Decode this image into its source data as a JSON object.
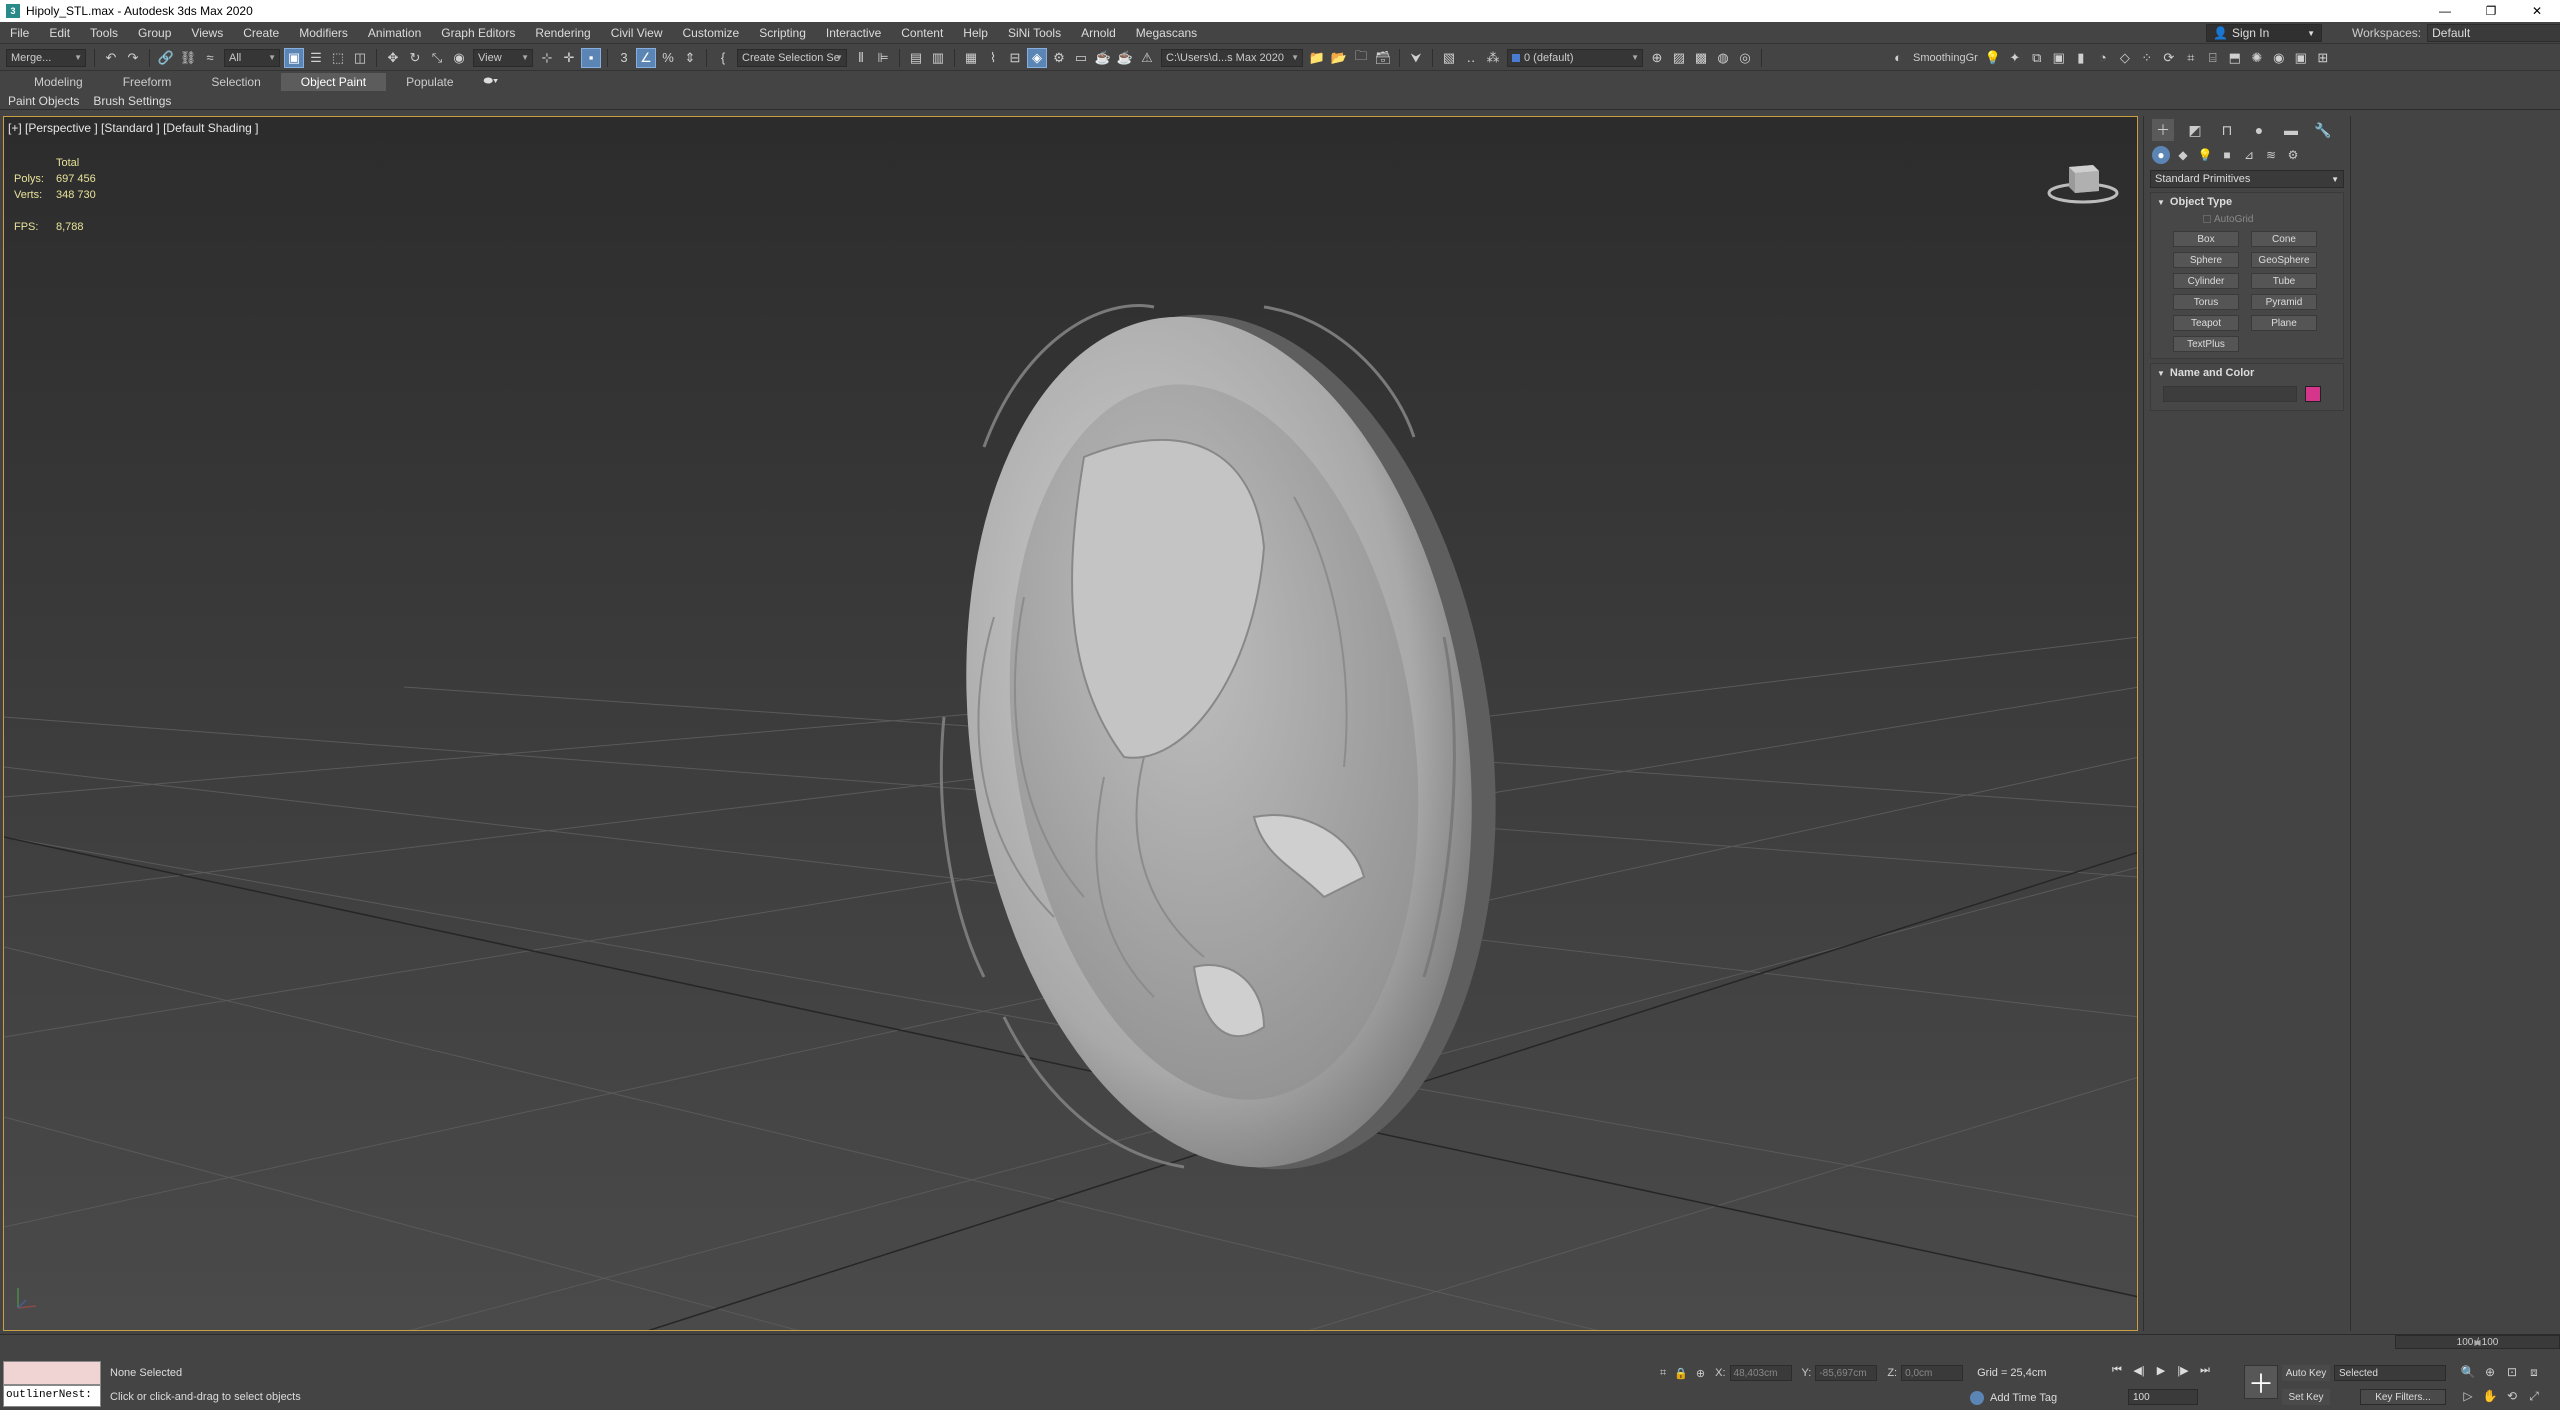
{
  "window": {
    "title": "Hipoly_STL.max - Autodesk 3ds Max 2020",
    "app_icon": "3",
    "minimize": "—",
    "restore": "❐",
    "close": "✕"
  },
  "menu": {
    "items": [
      "File",
      "Edit",
      "Tools",
      "Group",
      "Views",
      "Create",
      "Modifiers",
      "Animation",
      "Graph Editors",
      "Rendering",
      "Civil View",
      "Customize",
      "Scripting",
      "Interactive",
      "Content",
      "Help",
      "SiNi Tools",
      "Arnold",
      "Megascans"
    ],
    "sign_in": "Sign In",
    "workspaces_label": "Workspaces:",
    "workspaces_value": "Default"
  },
  "toolbar": {
    "merge": "Merge...",
    "selection_filter": "All",
    "ref_coord": "View",
    "named_selection": "Create Selection Se",
    "project_path": "C:\\Users\\d...s Max 2020",
    "layer": "0 (default)",
    "smoothing": "SmoothingGr"
  },
  "ribbon": {
    "tabs": [
      "Modeling",
      "Freeform",
      "Selection",
      "Object Paint",
      "Populate"
    ],
    "active_tab": "Object Paint",
    "sub_items": [
      "Paint Objects",
      "Brush Settings"
    ]
  },
  "viewport": {
    "label": "[+] [Perspective ] [Standard ] [Default Shading ]",
    "stats": {
      "total_label": "Total",
      "polys_label": "Polys:",
      "polys_value": "697 456",
      "verts_label": "Verts:",
      "verts_value": "348 730",
      "fps_label": "FPS:",
      "fps_value": "8,788"
    }
  },
  "command_panel": {
    "category": "Standard Primitives",
    "object_type_title": "Object Type",
    "autogrid": "AutoGrid",
    "primitives": [
      "Box",
      "Cone",
      "Sphere",
      "GeoSphere",
      "Cylinder",
      "Tube",
      "Torus",
      "Pyramid",
      "Teapot",
      "Plane",
      "TextPlus"
    ],
    "name_color_title": "Name and Color",
    "swatch_color": "#d6358c"
  },
  "status": {
    "selection": "None Selected",
    "prompt": "Click or click-and-drag to select objects",
    "maxscript": "outlinerNest:",
    "x_label": "X:",
    "x_value": "48,403cm",
    "y_label": "Y:",
    "y_value": "-85,697cm",
    "z_label": "Z:",
    "z_value": "0,0cm",
    "grid": "Grid = 25,4cm",
    "add_time_tag": "Add Time Tag",
    "time_slider": "100 / 100",
    "frame": "100",
    "auto_key": "Auto Key",
    "set_key": "Set Key",
    "key_mode": "Selected",
    "key_filters": "Key Filters..."
  },
  "colors": {
    "accent": "#5b85b5",
    "viewport_border": "#c8a043",
    "stats_text": "#e8e39a"
  }
}
